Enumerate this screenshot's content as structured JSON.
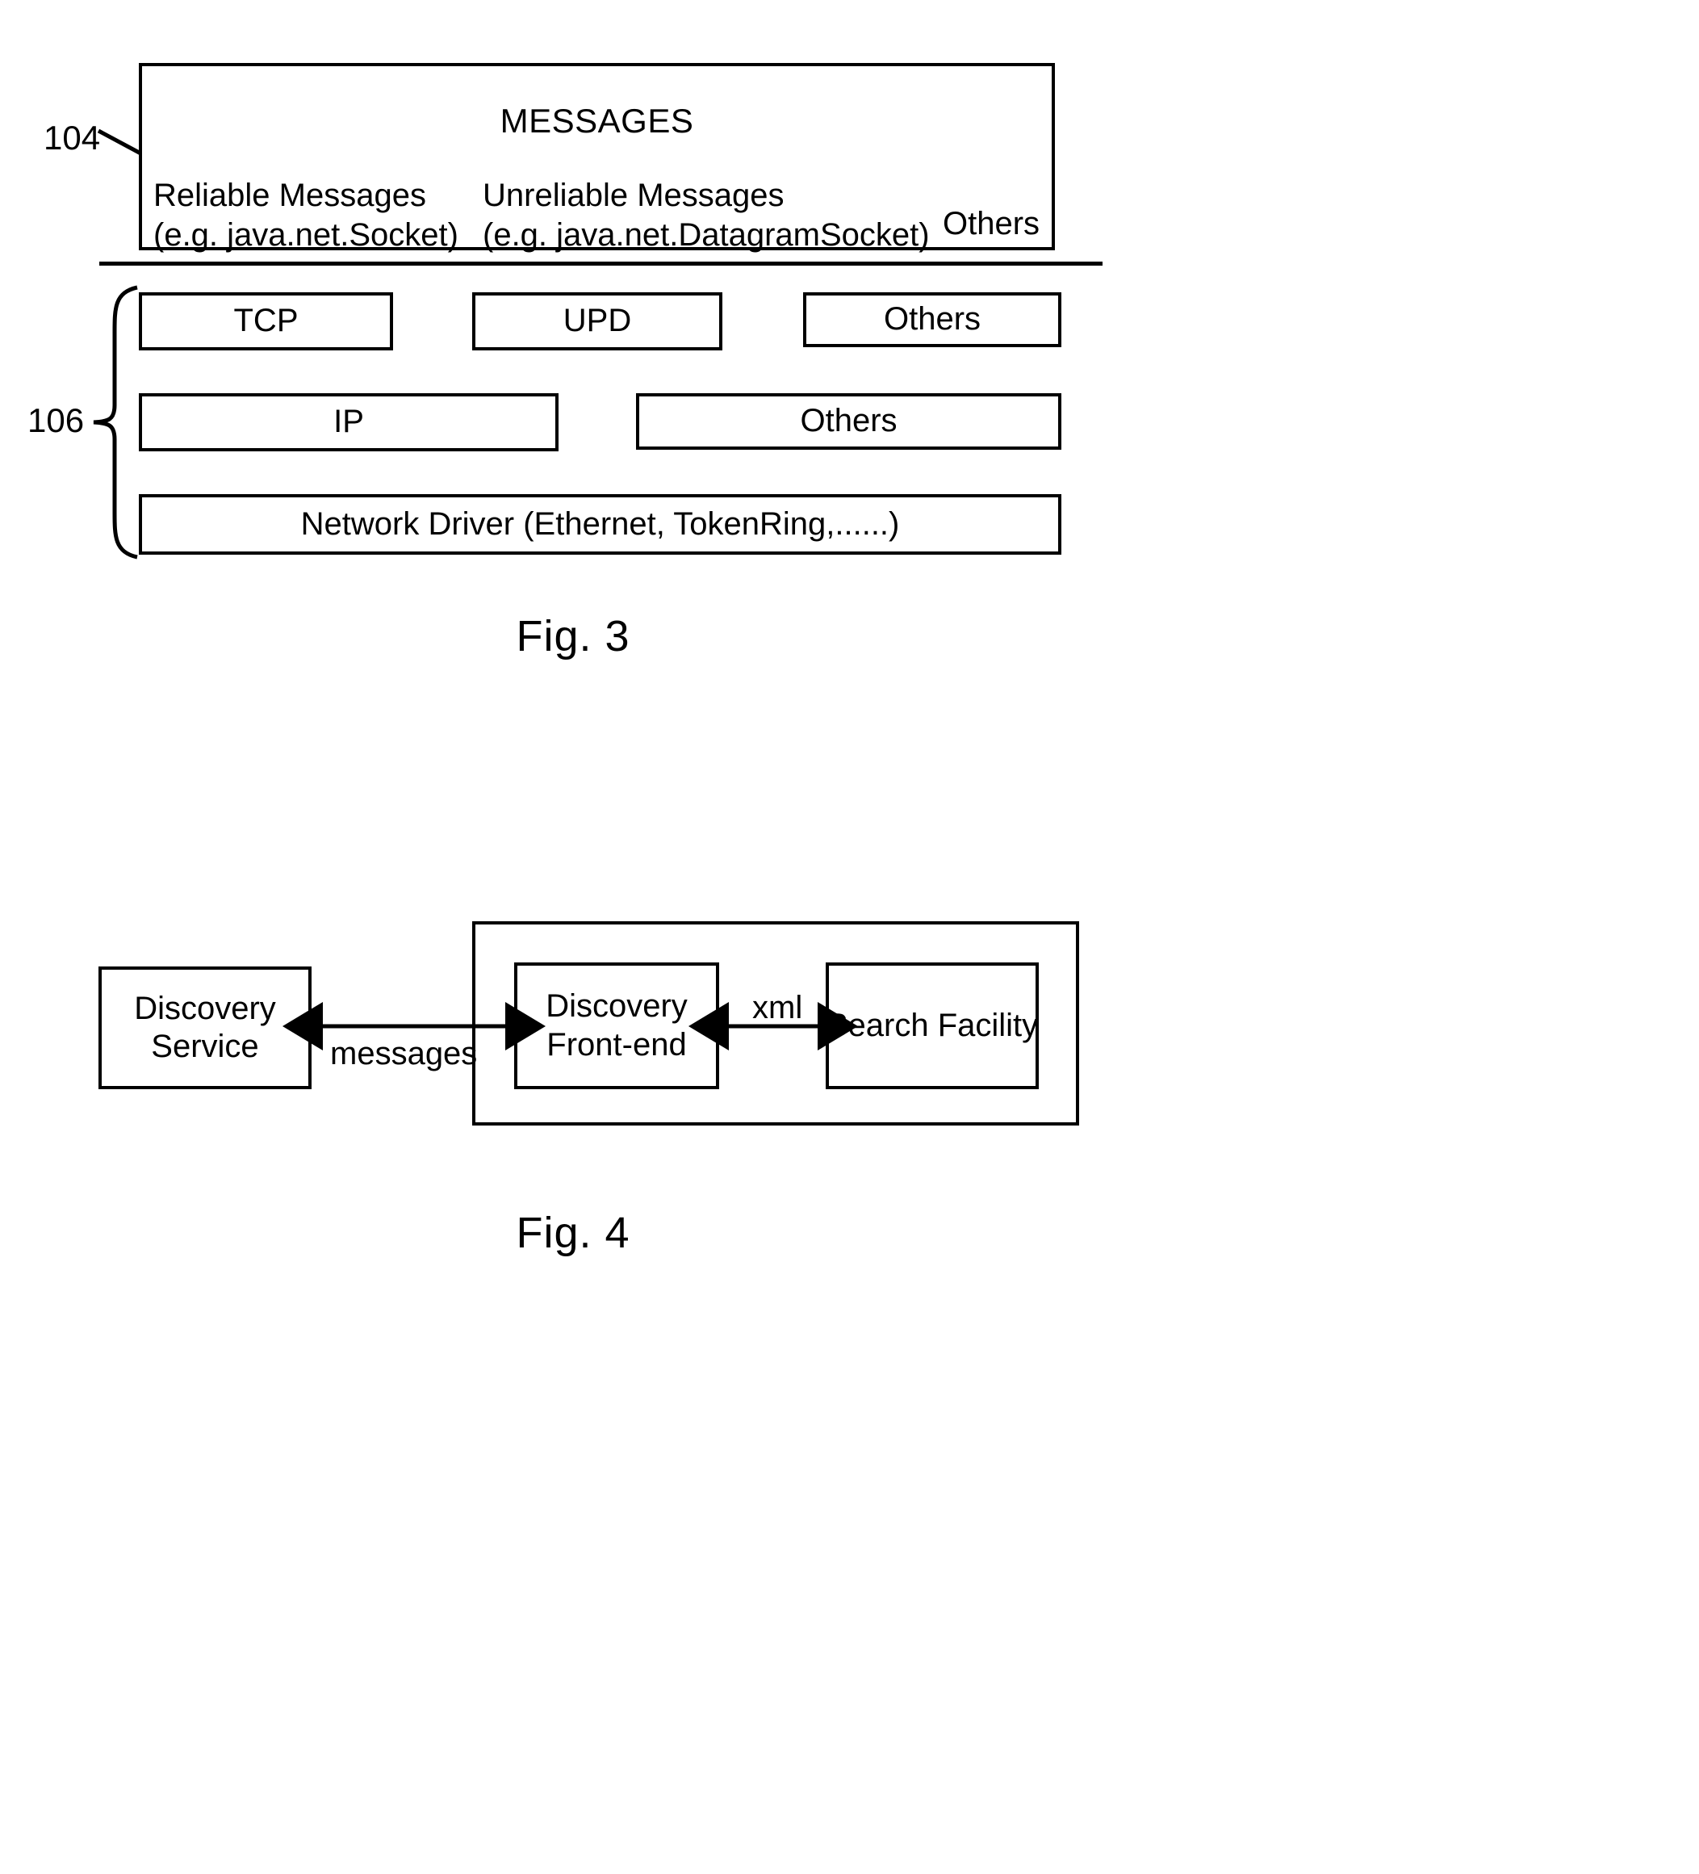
{
  "document": {
    "type": "patent-drawing-sheet",
    "figures": [
      "Fig. 3",
      "Fig. 4"
    ]
  },
  "fig3": {
    "caption": "Fig. 3",
    "reference_numerals": {
      "messages_layer": "104",
      "protocol_layer": "106"
    },
    "messages_box": {
      "title": "MESSAGES",
      "columns": [
        {
          "line1": "Reliable Messages",
          "line2": "(e.g. java.net.Socket)"
        },
        {
          "line1": "Unreliable Messages",
          "line2": "(e.g. java.net.DatagramSocket)"
        },
        {
          "line1": "Others",
          "line2": ""
        }
      ]
    },
    "protocol_rows": [
      {
        "boxes": [
          {
            "label": "TCP"
          },
          {
            "label": "UPD"
          },
          {
            "label": "Others"
          }
        ]
      },
      {
        "boxes": [
          {
            "label": "IP"
          },
          {
            "label": "Others"
          }
        ]
      },
      {
        "boxes": [
          {
            "label": "Network Driver (Ethernet, TokenRing,......)"
          }
        ]
      }
    ]
  },
  "fig4": {
    "caption": "Fig. 4",
    "nodes": [
      {
        "id": "discovery-service",
        "label_line1": "Discovery",
        "label_line2": "Service"
      },
      {
        "id": "discovery-frontend",
        "label_line1": "Discovery",
        "label_line2": "Front-end"
      },
      {
        "id": "search-facility",
        "label_line1": "Search Facility",
        "label_line2": ""
      }
    ],
    "connections": [
      {
        "from": "discovery-service",
        "to": "discovery-frontend",
        "label": "messages",
        "style": "double-headed"
      },
      {
        "from": "discovery-frontend",
        "to": "search-facility",
        "label": "xml",
        "style": "double-headed"
      }
    ]
  },
  "colors": {
    "ink": "#000000",
    "paper": "#ffffff"
  }
}
